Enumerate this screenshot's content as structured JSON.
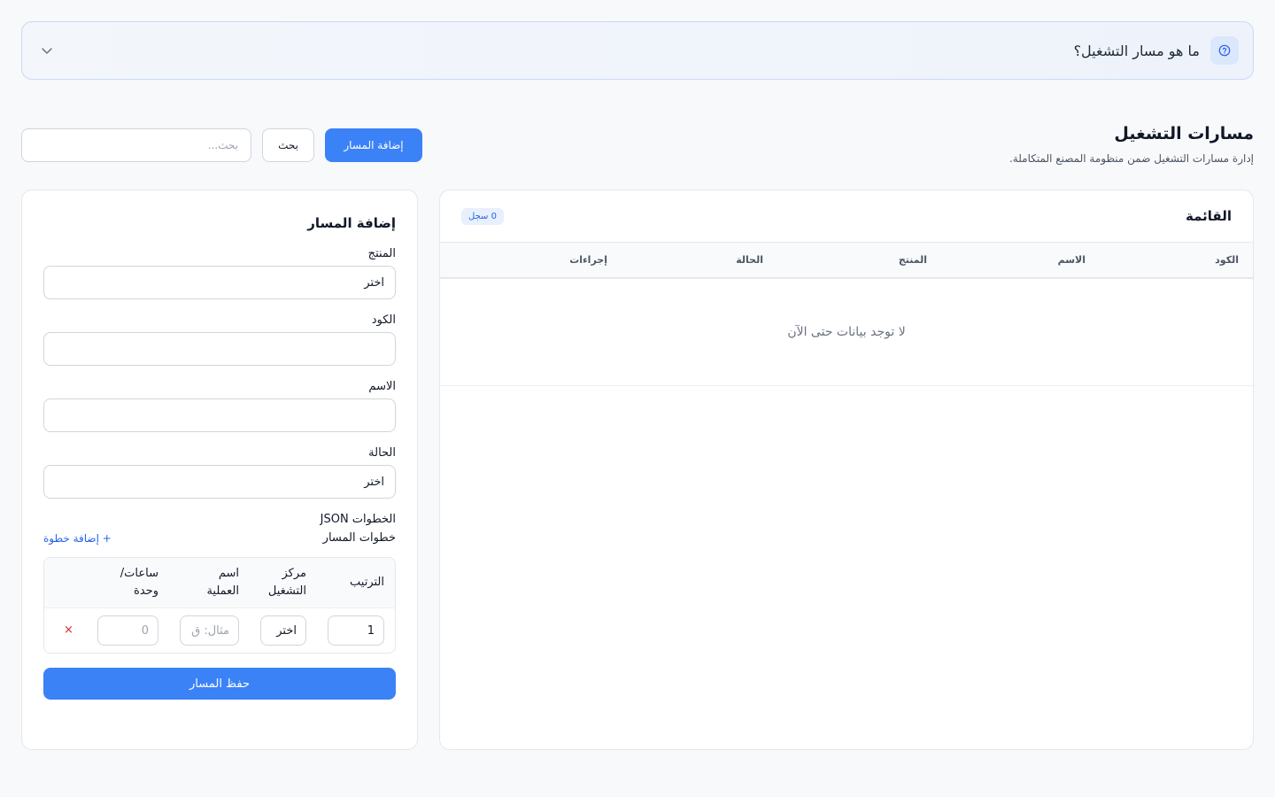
{
  "banner": {
    "title": "ما هو مسار التشغيل؟",
    "help_icon": "question-circle-icon",
    "toggle_icon": "chevron-down-icon"
  },
  "header": {
    "title": "مسارات التشغيل",
    "subtitle": "إدارة مسارات التشغيل ضمن منظومة المصنع المتكاملة.",
    "search_placeholder": "بحث...",
    "search_button": "بحث",
    "add_button": "إضافة المسار"
  },
  "list": {
    "title": "القائمة",
    "count": "0 سجل",
    "columns": [
      "الكود",
      "الاسم",
      "المنتج",
      "الحالة",
      "إجراءات"
    ],
    "empty_message": "لا توجد بيانات حتى الآن"
  },
  "form": {
    "title": "إضافة المسار",
    "product_label": "المنتج",
    "product_value": "اختر",
    "code_label": "الكود",
    "code_value": "",
    "name_label": "الاسم",
    "name_value": "",
    "status_label": "الحالة",
    "status_value": "اختر",
    "steps_json_label": "الخطوات JSON",
    "steps_label": "خطوات المسار",
    "add_step": "+ إضافة خطوة",
    "steps_columns": {
      "order": "الترتيب",
      "work_center_1": "مركز",
      "work_center_2": "التشغيل",
      "operation_1": "اسم",
      "operation_2": "العملية",
      "hours_1": "ساعات/",
      "hours_2": "وحدة"
    },
    "step_row": {
      "order": "1",
      "work_center": "اختر",
      "operation_placeholder": "مثال: ق",
      "hours_placeholder": "0",
      "remove": "×"
    },
    "save_button": "حفظ المسار"
  },
  "colors": {
    "accent": "#3b82f6",
    "danger": "#dc2626",
    "banner_border": "#c9daf3"
  }
}
